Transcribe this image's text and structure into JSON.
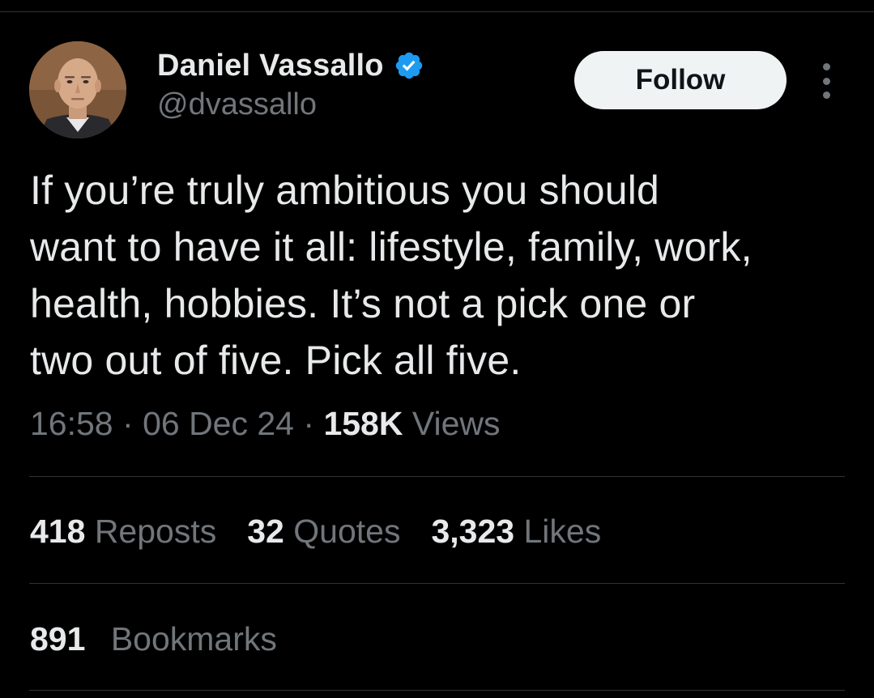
{
  "author": {
    "display_name": "Daniel Vassallo",
    "handle": "@dvassallo",
    "verified_icon": "verified-badge-icon",
    "verified_color": "#1d9bf0"
  },
  "actions": {
    "follow_label": "Follow",
    "more_icon": "more-options-icon"
  },
  "tweet": {
    "text": "If you’re truly ambitious you should\nwant to have it all: lifestyle, family, work,\nhealth, hobbies. It’s not a pick one or\ntwo out of five. Pick all five."
  },
  "meta": {
    "time": "16:58",
    "separator": "·",
    "date": "06 Dec 24",
    "views_count": "158K",
    "views_label": "Views"
  },
  "stats": [
    {
      "count": "418",
      "label": "Reposts"
    },
    {
      "count": "32",
      "label": "Quotes"
    },
    {
      "count": "3,323",
      "label": "Likes"
    }
  ],
  "bookmarks": {
    "count": "891",
    "label": "Bookmarks"
  },
  "colors": {
    "background": "#000000",
    "primary_text": "#e7e9ea",
    "secondary_text": "#71767b",
    "divider": "#2f3336",
    "follow_bg": "#eff3f4"
  }
}
